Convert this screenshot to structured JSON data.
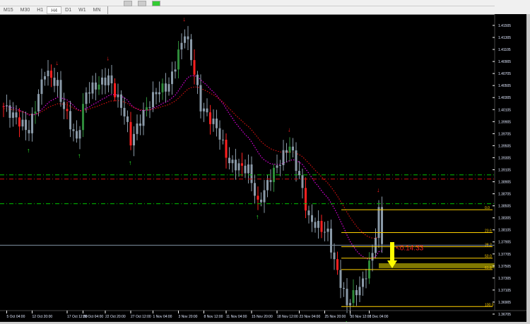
{
  "toolbar": {
    "timeframes": [
      "M15",
      "M30",
      "H1",
      "H4",
      "D1",
      "W1",
      "MN"
    ],
    "active": "H4"
  },
  "countdown": "<0:14:33",
  "current_price": "1.37850",
  "colors": {
    "bull": "#2e8b3a",
    "bear": "#ff2020",
    "neutral": "#8a9aa8",
    "ma_fast": "#e000e0",
    "ma_slow": "#d01010",
    "fib": "#ffd000",
    "support": "#00c000"
  },
  "chart_data": {
    "type": "candlestick",
    "price_axis": [
      "1.41505",
      "1.41305",
      "1.41105",
      "1.40905",
      "1.40705",
      "1.40505",
      "1.40305",
      "1.40105",
      "1.39905",
      "1.39705",
      "1.39505",
      "1.39305",
      "1.39105",
      "1.38905",
      "1.38705",
      "1.38505",
      "1.38305",
      "1.38105",
      "1.37905",
      "1.37705",
      "1.37505",
      "1.37305",
      "1.37105",
      "1.36905",
      "1.36705"
    ],
    "ylim": [
      1.364,
      1.417
    ],
    "time_axis": [
      "5 Oct 04:00",
      "12 Oct 20:00",
      "17 Oct 12:00",
      "20 Oct 04:00",
      "22 Oct 20:00",
      "27 Oct 12:00",
      "1 Nov 04:00",
      "3 Nov 20:00",
      "8 Nov 12:00",
      "11 Nov 04:00",
      "15 Nov 20:00",
      "18 Nov 12:00",
      "23 Nov 04:00",
      "25 Nov 20:00",
      "30 Nov 12:00",
      "3 Dec 04:00"
    ],
    "time_axis_candle_index": [
      1,
      9,
      20,
      25,
      32,
      40,
      47,
      55,
      63,
      70,
      78,
      86,
      93,
      101,
      109,
      115
    ],
    "close_keypoints": [
      [
        0,
        1.4016
      ],
      [
        8,
        1.3975
      ],
      [
        13,
        1.4075
      ],
      [
        17,
        1.4051
      ],
      [
        18,
        1.4028
      ],
      [
        23,
        1.3958
      ],
      [
        26,
        1.404
      ],
      [
        33,
        1.4063
      ],
      [
        38,
        1.4004
      ],
      [
        40,
        1.3958
      ],
      [
        44,
        1.4004
      ],
      [
        48,
        1.404
      ],
      [
        52,
        1.4051
      ],
      [
        57,
        1.4139
      ],
      [
        59,
        1.4098
      ],
      [
        62,
        1.4016
      ],
      [
        67,
        1.3981
      ],
      [
        71,
        1.3922
      ],
      [
        77,
        1.3911
      ],
      [
        80,
        1.3852
      ],
      [
        84,
        1.3899
      ],
      [
        90,
        1.3952
      ],
      [
        93,
        1.3899
      ],
      [
        96,
        1.3828
      ],
      [
        102,
        1.3805
      ],
      [
        104,
        1.3758
      ],
      [
        108,
        1.3687
      ],
      [
        113,
        1.3723
      ],
      [
        116,
        1.377
      ],
      [
        118,
        1.384
      ],
      [
        119,
        1.3787
      ]
    ],
    "fractal_up_index": [
      17,
      33,
      57,
      90,
      118
    ],
    "fractal_down_index": [
      8,
      24,
      40,
      80,
      108
    ],
    "horizontal_lines": [
      {
        "price": 1.3902,
        "style": "support"
      },
      {
        "price": 1.3895,
        "style": "resistance"
      },
      {
        "price": 1.3854,
        "style": "support"
      }
    ],
    "fibonacci": {
      "high": 1.3844,
      "low": 1.3683,
      "levels": [
        "0.0",
        "23.6",
        "38.2",
        "50.0",
        "61.8",
        "100.0"
      ]
    },
    "target_zone_level": "61.8"
  }
}
